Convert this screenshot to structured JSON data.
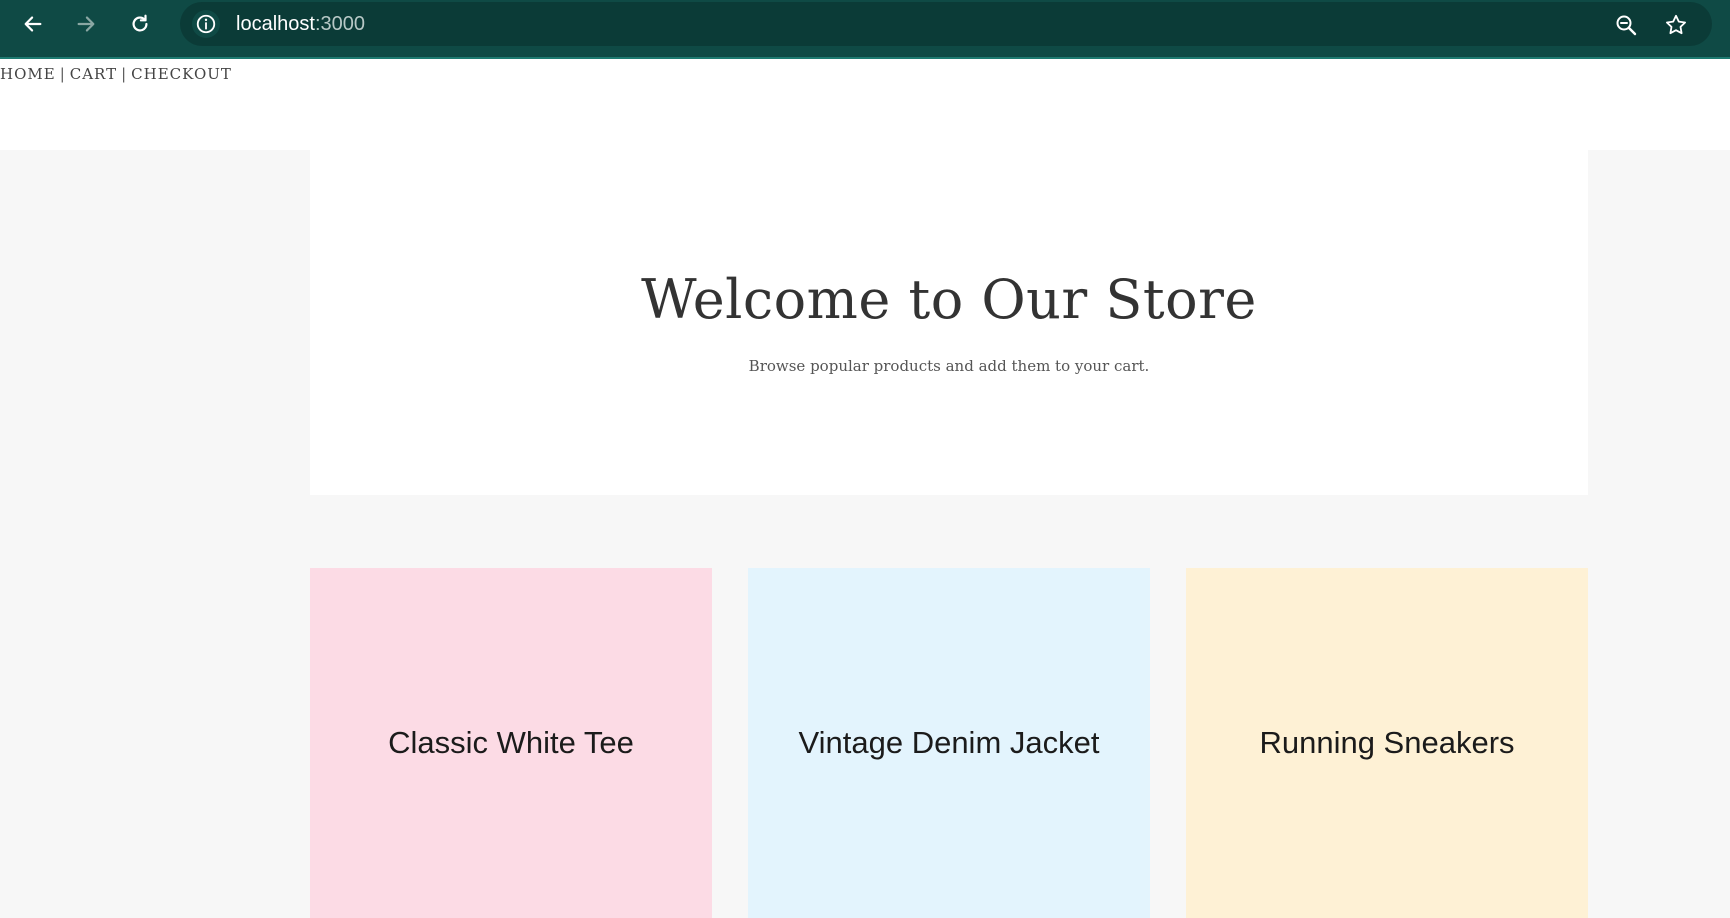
{
  "browser": {
    "url_host": "localhost",
    "url_port": ":3000",
    "icons": [
      "back-arrow-icon",
      "forward-arrow-icon",
      "reload-icon",
      "info-icon",
      "zoom-icon",
      "star-icon"
    ]
  },
  "nav": {
    "home": "HOME",
    "cart": "CART",
    "checkout": "CHECKOUT",
    "separator": "|"
  },
  "hero": {
    "title": "Welcome to Our Store",
    "subtitle": "Browse popular products and add them to your cart."
  },
  "products": [
    {
      "name": "Classic White Tee",
      "color": "#fcdbe5"
    },
    {
      "name": "Vintage Denim Jacket",
      "color": "#e3f4fd"
    },
    {
      "name": "Running Sneakers",
      "color": "#fef1d5"
    }
  ],
  "colors": {
    "browser_bar": "#0f4a45",
    "address_bar": "#0b3b37",
    "page_bg": "#f7f7f7"
  }
}
